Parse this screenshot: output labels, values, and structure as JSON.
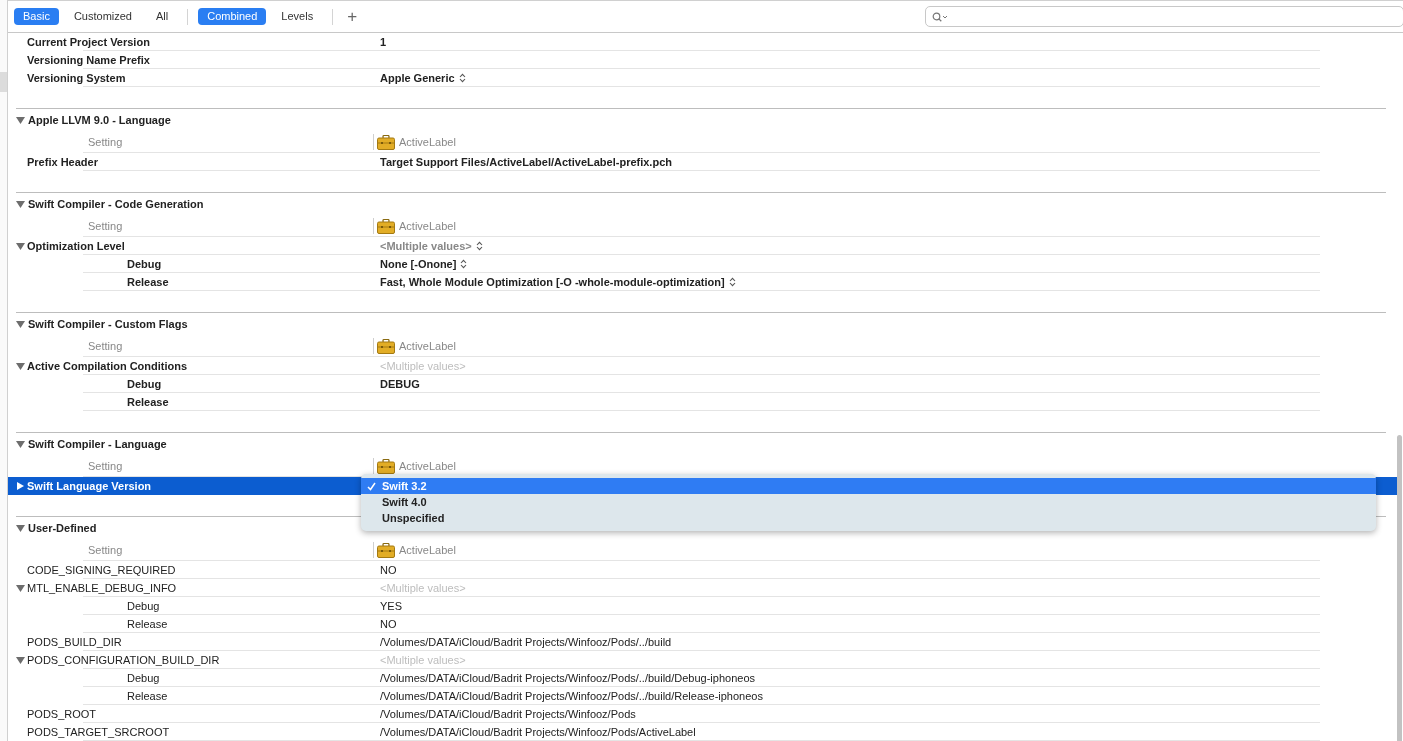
{
  "toolbar": {
    "scope_tabs": [
      {
        "label": "Basic",
        "selected": true
      },
      {
        "label": "Customized",
        "selected": false
      },
      {
        "label": "All",
        "selected": false
      }
    ],
    "view_tabs": [
      {
        "label": "Combined",
        "selected": true
      },
      {
        "label": "Levels",
        "selected": false
      }
    ],
    "add_button": "+"
  },
  "sections": [
    {
      "bold": true,
      "rows": [
        {
          "kind": "plain",
          "name": "Current Project Version",
          "value": "1",
          "popup": false,
          "selected": false
        },
        {
          "kind": "plain",
          "name": "Versioning Name Prefix",
          "popup": false,
          "selected": false
        },
        {
          "kind": "plain",
          "name": "Versioning System",
          "value": "Apple Generic",
          "popup": true,
          "selected": false
        }
      ]
    },
    {
      "title": "Apple LLVM 9.0 - Language",
      "expanded": true,
      "bold": true,
      "rows": [
        {
          "kind": "setting",
          "label": "Setting",
          "target": "ActiveLabel"
        },
        {
          "kind": "plain",
          "name": "Prefix Header",
          "value": "Target Support Files/ActiveLabel/ActiveLabel-prefix.pch",
          "popup": false,
          "selected": false
        }
      ]
    },
    {
      "title": "Swift Compiler - Code Generation",
      "expanded": true,
      "bold": true,
      "rows": [
        {
          "kind": "setting",
          "label": "Setting",
          "target": "ActiveLabel"
        },
        {
          "kind": "group",
          "name": "Optimization Level",
          "value": "<Multiple values>",
          "dimmed": false,
          "popup": true,
          "expanded": true,
          "selected": false,
          "children": [
            {
              "name": "Debug",
              "value": "None [-Onone]",
              "popup": true
            },
            {
              "name": "Release",
              "value": "Fast, Whole Module Optimization  [-O -whole-module-optimization]",
              "popup": true
            }
          ]
        }
      ]
    },
    {
      "title": "Swift Compiler - Custom Flags",
      "expanded": true,
      "bold": true,
      "rows": [
        {
          "kind": "setting",
          "label": "Setting",
          "target": "ActiveLabel"
        },
        {
          "kind": "group",
          "name": "Active Compilation Conditions",
          "value": "<Multiple values>",
          "dimmed": true,
          "popup": false,
          "expanded": true,
          "selected": false,
          "children": [
            {
              "name": "Debug",
              "value": "DEBUG",
              "popup": false
            },
            {
              "name": "Release",
              "popup": false
            }
          ]
        }
      ]
    },
    {
      "title": "Swift Compiler - Language",
      "expanded": true,
      "bold": true,
      "rows": [
        {
          "kind": "setting",
          "label": "Setting",
          "target": "ActiveLabel"
        },
        {
          "kind": "group",
          "name": "Swift Language Version",
          "popup": false,
          "expanded": false,
          "selected": true,
          "menu": [
            {
              "label": "Swift 3.2",
              "selected": true
            },
            {
              "label": "Swift 4.0",
              "selected": false
            },
            {
              "label": "Unspecified",
              "selected": false
            }
          ]
        }
      ]
    },
    {
      "title": "User-Defined",
      "expanded": true,
      "bold": false,
      "rows": [
        {
          "kind": "setting",
          "label": "Setting",
          "target": "ActiveLabel"
        },
        {
          "kind": "plain",
          "name": "CODE_SIGNING_REQUIRED",
          "value": "NO",
          "popup": false,
          "selected": false
        },
        {
          "kind": "group",
          "name": "MTL_ENABLE_DEBUG_INFO",
          "value": "<Multiple values>",
          "dimmed": true,
          "popup": false,
          "expanded": true,
          "selected": false,
          "children": [
            {
              "name": "Debug",
              "value": "YES",
              "popup": false
            },
            {
              "name": "Release",
              "value": "NO",
              "popup": false
            }
          ]
        },
        {
          "kind": "plain",
          "name": "PODS_BUILD_DIR",
          "value": "/Volumes/DATA/iCloud/Badrit Projects/Winfooz/Pods/../build",
          "popup": false,
          "selected": false
        },
        {
          "kind": "group",
          "name": "PODS_CONFIGURATION_BUILD_DIR",
          "value": "<Multiple values>",
          "dimmed": true,
          "popup": false,
          "expanded": true,
          "selected": false,
          "children": [
            {
              "name": "Debug",
              "value": "/Volumes/DATA/iCloud/Badrit Projects/Winfooz/Pods/../build/Debug-iphoneos",
              "popup": false
            },
            {
              "name": "Release",
              "value": "/Volumes/DATA/iCloud/Badrit Projects/Winfooz/Pods/../build/Release-iphoneos",
              "popup": false
            }
          ]
        },
        {
          "kind": "plain",
          "name": "PODS_ROOT",
          "value": "/Volumes/DATA/iCloud/Badrit Projects/Winfooz/Pods",
          "popup": false,
          "selected": false
        },
        {
          "kind": "plain",
          "name": "PODS_TARGET_SRCROOT",
          "value": "/Volumes/DATA/iCloud/Badrit Projects/Winfooz/Pods/ActiveLabel",
          "popup": false,
          "selected": false
        }
      ]
    }
  ]
}
